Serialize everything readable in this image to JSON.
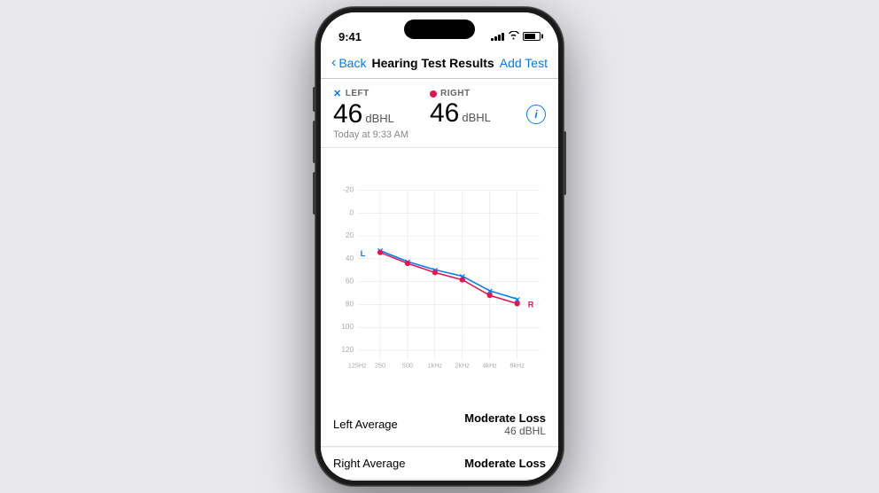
{
  "status": {
    "time": "9:41"
  },
  "nav": {
    "back_label": "Back",
    "title": "Hearing Test Results",
    "add_label": "Add Test"
  },
  "results": {
    "left": {
      "ear": "LEFT",
      "value": "46",
      "unit": "dBHL"
    },
    "right": {
      "ear": "RIGHT",
      "value": "46",
      "unit": "dBHL"
    },
    "date": "Today at 9:33 AM"
  },
  "chart": {
    "y_labels": [
      "-20",
      "0",
      "20",
      "40",
      "60",
      "80",
      "100",
      "120"
    ],
    "x_labels": [
      "125Hz",
      "250",
      "500",
      "1kHz",
      "2kHz",
      "4kHz",
      "8kHz"
    ]
  },
  "summary": [
    {
      "label": "Left Average",
      "value_title": "Moderate Loss",
      "value_sub": "46 dBHL"
    },
    {
      "label": "Right Average",
      "value_title": "Moderate Loss",
      "value_sub": ""
    }
  ]
}
